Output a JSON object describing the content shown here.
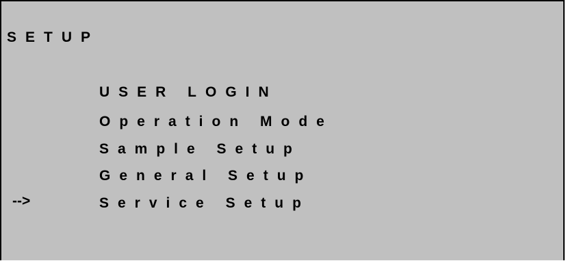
{
  "screen": {
    "title": "SETUP",
    "cursor": "-->",
    "selected_index": 4,
    "menu_items": [
      {
        "label": "USER LOGIN"
      },
      {
        "label": "Operation Mode"
      },
      {
        "label": "Sample Setup"
      },
      {
        "label": "General Setup"
      },
      {
        "label": "Service Setup"
      }
    ]
  },
  "colors": {
    "background": "#c0c0c0",
    "text": "#000000"
  }
}
